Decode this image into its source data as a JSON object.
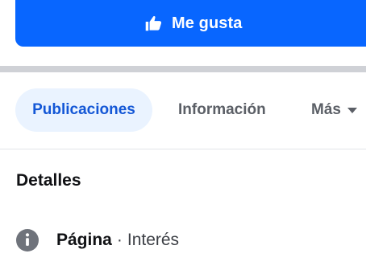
{
  "actions": {
    "like_label": "Me gusta",
    "like_icon": "thumbs-up-icon",
    "brand_color": "#0866ff"
  },
  "tabs": [
    {
      "label": "Publicaciones",
      "active": true
    },
    {
      "label": "Información",
      "active": false
    },
    {
      "label": "Más",
      "active": false,
      "icon": "chevron-down-icon"
    }
  ],
  "details": {
    "title": "Detalles",
    "rows": [
      {
        "icon": "info-icon",
        "label": "Página",
        "separator": "·",
        "value": "Interés"
      }
    ]
  }
}
